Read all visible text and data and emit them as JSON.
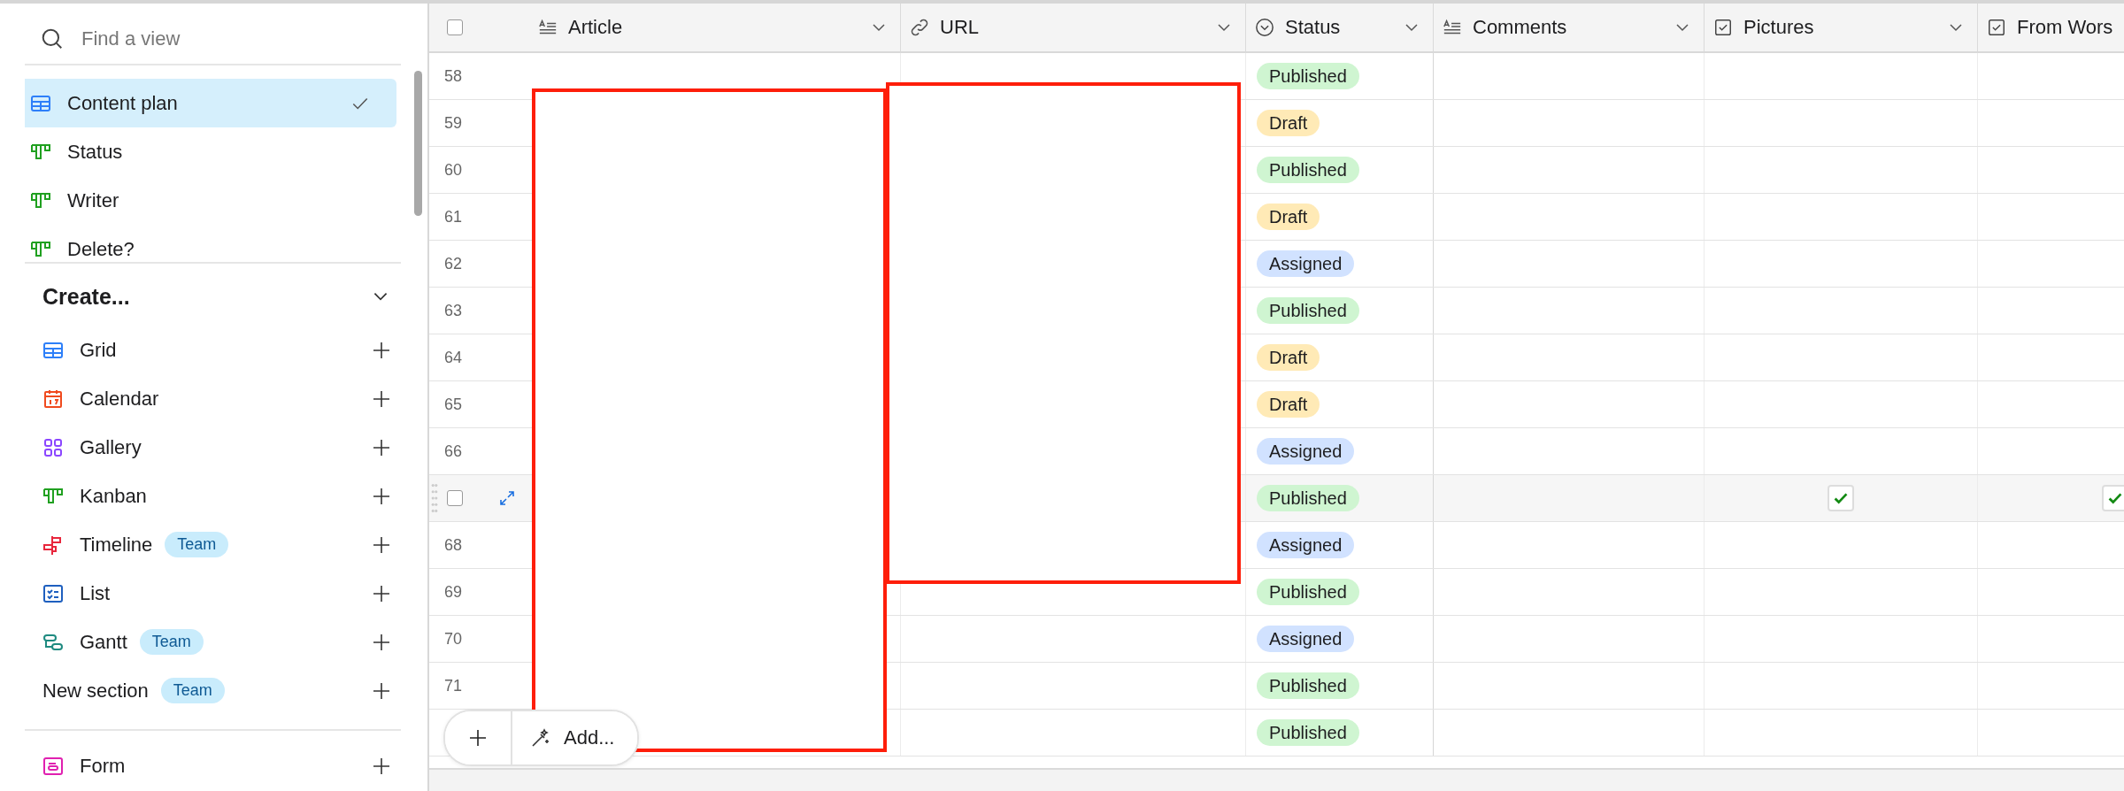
{
  "sidebar": {
    "search": {
      "placeholder": "Find a view"
    },
    "views": [
      {
        "label": "Content plan",
        "kind": "grid",
        "selected": true
      },
      {
        "label": "Status",
        "kind": "kanban",
        "selected": false
      },
      {
        "label": "Writer",
        "kind": "kanban",
        "selected": false
      },
      {
        "label": "Delete?",
        "kind": "kanban",
        "selected": false
      }
    ],
    "create": {
      "title": "Create...",
      "expanded": true,
      "items": [
        {
          "label": "Grid",
          "kind": "grid"
        },
        {
          "label": "Calendar",
          "kind": "calendar"
        },
        {
          "label": "Gallery",
          "kind": "gallery"
        },
        {
          "label": "Kanban",
          "kind": "kanban"
        },
        {
          "label": "Timeline",
          "kind": "timeline",
          "badge": "Team"
        },
        {
          "label": "List",
          "kind": "list"
        },
        {
          "label": "Gantt",
          "kind": "gantt",
          "badge": "Team"
        },
        {
          "label": "New section",
          "kind": "section",
          "badge": "Team"
        }
      ],
      "more": [
        {
          "label": "Form",
          "kind": "form"
        }
      ]
    }
  },
  "table": {
    "select_all": {
      "checked": false
    },
    "columns": [
      {
        "label": "Article",
        "kind": "text"
      },
      {
        "label": "URL",
        "kind": "url"
      },
      {
        "label": "Status",
        "kind": "select"
      },
      {
        "label": "Comments",
        "kind": "text"
      },
      {
        "label": "Pictures",
        "kind": "checkbox"
      },
      {
        "label": "From Wors",
        "kind": "checkbox"
      }
    ],
    "rows": [
      {
        "number": "58",
        "hovered": false,
        "status": {
          "label": "Published",
          "color": "#cff5d1"
        },
        "pictures": false,
        "from_worst": false
      },
      {
        "number": "59",
        "hovered": false,
        "status": {
          "label": "Draft",
          "color": "#ffeab6"
        },
        "pictures": false,
        "from_worst": false
      },
      {
        "number": "60",
        "hovered": false,
        "status": {
          "label": "Published",
          "color": "#cff5d1"
        },
        "pictures": false,
        "from_worst": false
      },
      {
        "number": "61",
        "hovered": false,
        "status": {
          "label": "Draft",
          "color": "#ffeab6"
        },
        "pictures": false,
        "from_worst": false
      },
      {
        "number": "62",
        "hovered": false,
        "status": {
          "label": "Assigned",
          "color": "#d1e2ff"
        },
        "pictures": false,
        "from_worst": false
      },
      {
        "number": "63",
        "hovered": false,
        "status": {
          "label": "Published",
          "color": "#cff5d1"
        },
        "pictures": false,
        "from_worst": false
      },
      {
        "number": "64",
        "hovered": false,
        "status": {
          "label": "Draft",
          "color": "#ffeab6"
        },
        "pictures": false,
        "from_worst": false
      },
      {
        "number": "65",
        "hovered": false,
        "status": {
          "label": "Draft",
          "color": "#ffeab6"
        },
        "pictures": false,
        "from_worst": false
      },
      {
        "number": "66",
        "hovered": false,
        "status": {
          "label": "Assigned",
          "color": "#d1e2ff"
        },
        "pictures": false,
        "from_worst": false
      },
      {
        "hovered": true,
        "checked": false,
        "status": {
          "label": "Published",
          "color": "#cff5d1"
        },
        "pictures": true,
        "from_worst": true
      },
      {
        "number": "68",
        "hovered": false,
        "status": {
          "label": "Assigned",
          "color": "#d1e2ff"
        },
        "pictures": false,
        "from_worst": false
      },
      {
        "number": "69",
        "hovered": false,
        "status": {
          "label": "Published",
          "color": "#cff5d1"
        },
        "pictures": false,
        "from_worst": false
      },
      {
        "number": "70",
        "hovered": false,
        "status": {
          "label": "Assigned",
          "color": "#d1e2ff"
        },
        "pictures": false,
        "from_worst": false
      },
      {
        "number": "71",
        "hovered": false,
        "status": {
          "label": "Published",
          "color": "#cff5d1"
        },
        "pictures": false,
        "from_worst": false
      },
      {
        "hovered": false,
        "status": {
          "label": "Published",
          "color": "#cff5d1"
        },
        "pictures": false,
        "from_worst": false
      }
    ],
    "add_button": {
      "label": "Add..."
    }
  }
}
